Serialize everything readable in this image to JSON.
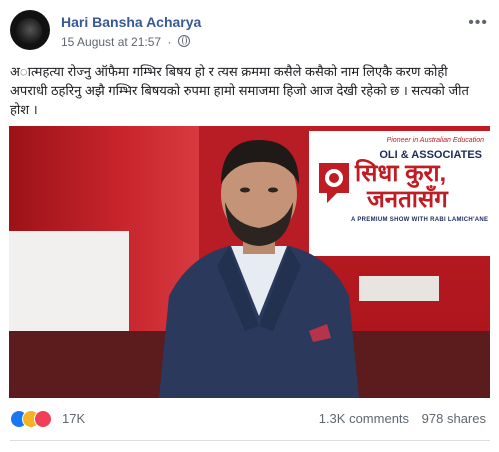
{
  "post": {
    "author": "Hari Bansha Acharya",
    "date": "15 August at 21:57",
    "privacy_icon": "globe-icon",
    "more_icon": "more-options-icon",
    "text": "अात्महत्या रोज्नु ऑफैमा गम्भिर बिषय हो र त्यस क्रममा कसैले कसैको नाम लिएकै करण कोही अपराधी ठहरिनु अझै गम्भिर बिषयको रुपमा हामो समाजमा हिजो आज देखी रहेको छ । सत्यको जीत होश ।"
  },
  "media": {
    "screen_tagline": "Pioneer in Australian Education",
    "screen_brand": "OLI & ASSOCIATES",
    "show_title_line1": "सिधा कुरा,",
    "show_title_line2": "जनतासँग",
    "show_subtitle": "A PREMIUM SHOW WITH RABI LAMICH'ANE"
  },
  "footer": {
    "reaction_count": "17K",
    "comments": "1.3K comments",
    "shares": "978 shares",
    "reactions": [
      "like-icon",
      "sad-icon",
      "love-icon"
    ]
  },
  "colors": {
    "link": "#385898",
    "like": "#1877f2",
    "sad": "#f7b125",
    "love": "#f33e58",
    "studio_red": "#b81c25"
  }
}
